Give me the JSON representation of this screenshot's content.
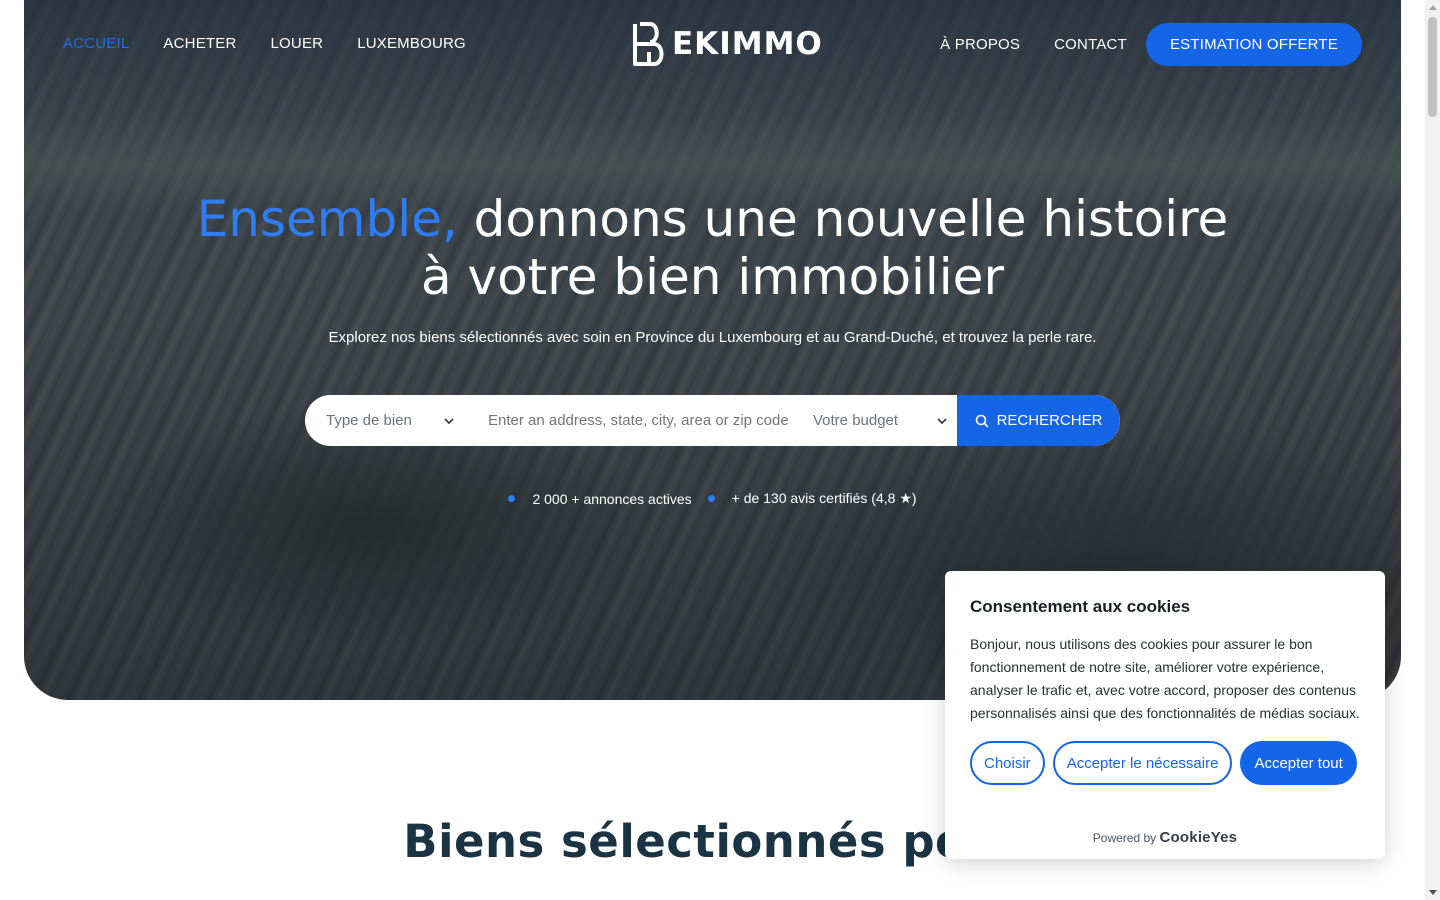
{
  "nav": {
    "left": [
      "ACCUEIL",
      "ACHETER",
      "LOUER",
      "LUXEMBOURG"
    ],
    "right": [
      "À PROPOS",
      "CONTACT"
    ],
    "cta": "ESTIMATION OFFERTE",
    "active_index": 0
  },
  "logo": {
    "text": "EKIMMO"
  },
  "hero": {
    "headline_accent": "Ensemble,",
    "headline_rest": " donnons une nouvelle histoire",
    "headline_line2": "à votre bien immobilier",
    "subline": "Explorez nos biens sélectionnés avec soin en Province du Luxembourg et au Grand-Duché, et trouvez la perle rare."
  },
  "search": {
    "type_placeholder": "Type de bien",
    "address_placeholder": "Enter an address, state, city, area or zip code",
    "budget_placeholder": "Votre budget",
    "button": "RECHERCHER"
  },
  "stats": [
    "2 000 + annonces actives",
    "+ de 130 avis certifiés (4,8 ★)"
  ],
  "section": {
    "title": "Biens sélectionnés pour"
  },
  "cookie": {
    "title": "Consentement aux cookies",
    "body": "Bonjour, nous utilisons des cookies pour assurer le bon fonctionnement de notre site, améliorer votre expérience, analyser le trafic et, avec votre accord, proposer des contenus personnalisés ainsi que des fonctionnalités de médias sociaux.",
    "btn_choose": "Choisir",
    "btn_necessary": "Accepter le nécessaire",
    "btn_all": "Accepter tout",
    "powered_by": "Powered by",
    "brand": "CookieYes"
  },
  "colors": {
    "accent": "#1565e8",
    "headline_accent": "#2f7df2",
    "title": "#1b3443"
  }
}
